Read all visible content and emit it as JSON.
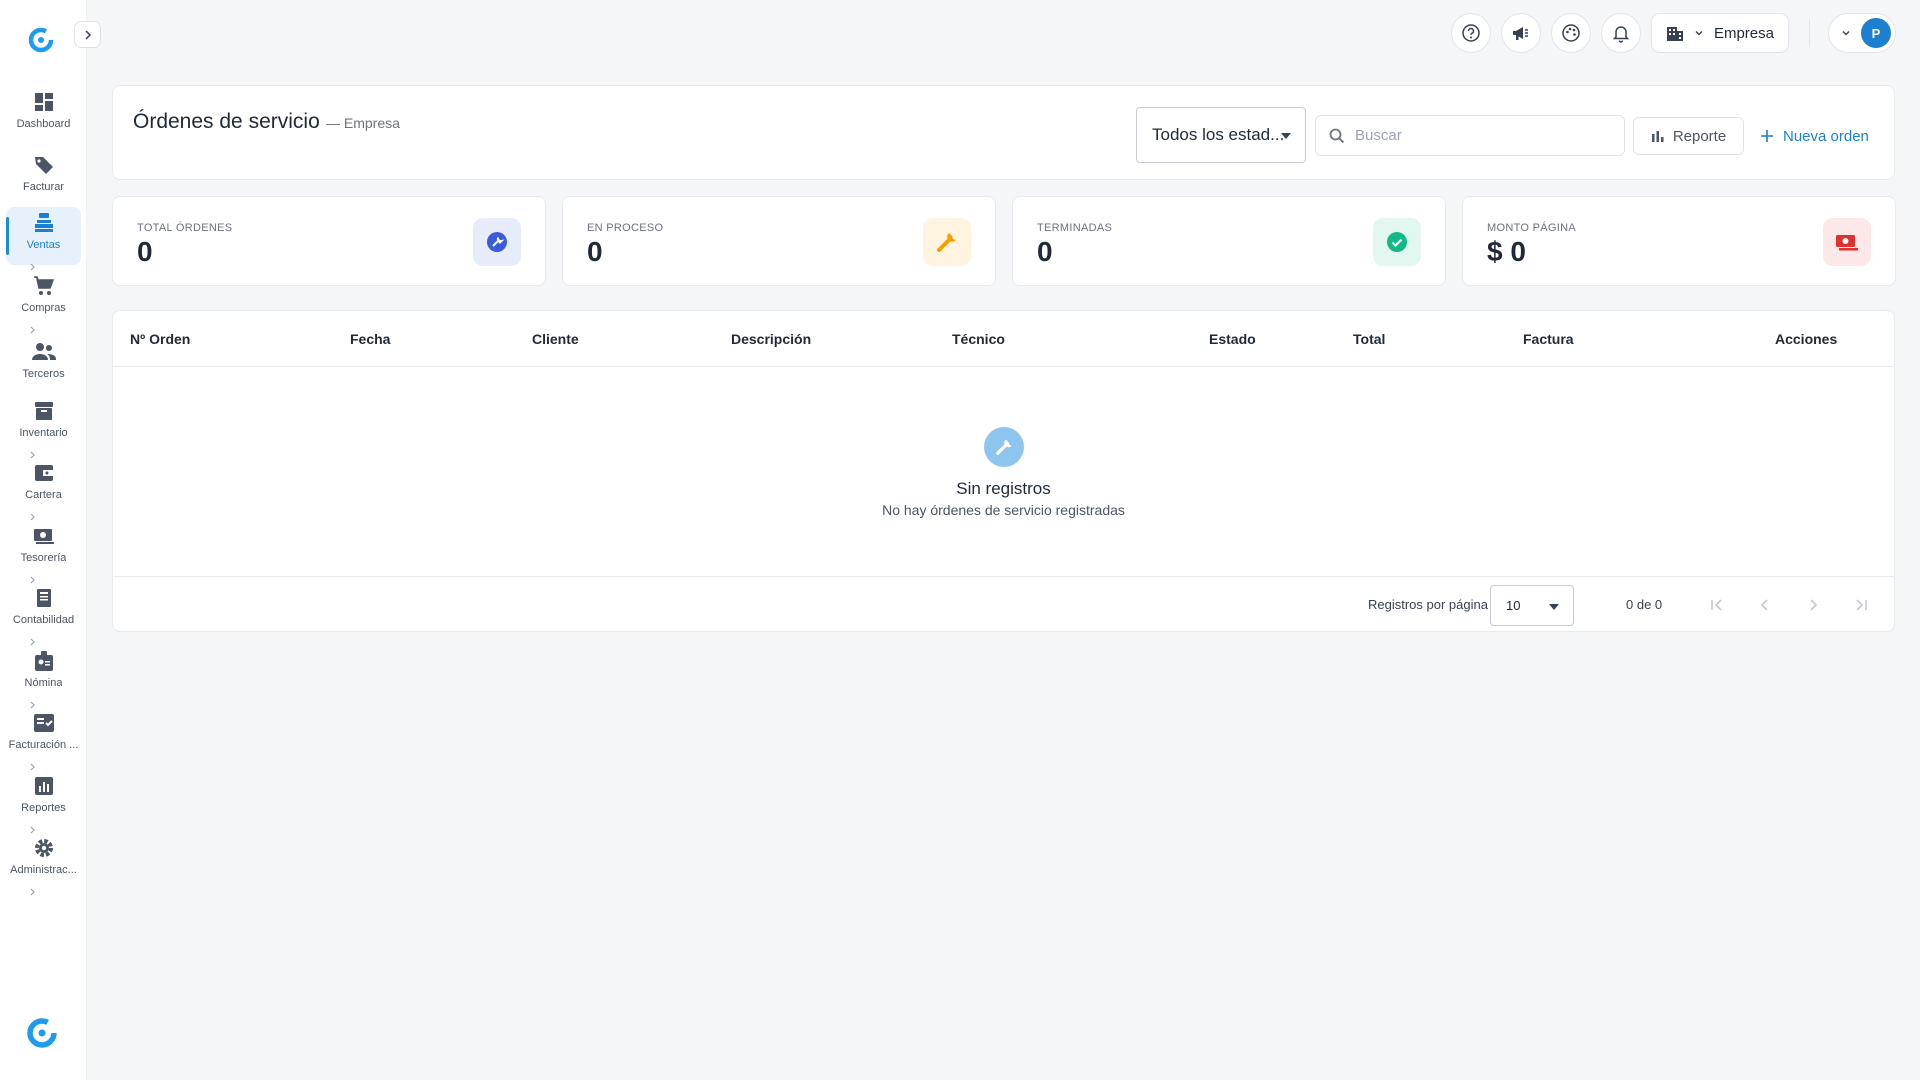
{
  "sidebar": {
    "items": [
      {
        "label": "Dashboard",
        "icon": "dashboard-icon"
      },
      {
        "label": "Facturar",
        "icon": "tag-icon"
      },
      {
        "label": "Ventas",
        "icon": "pos-register-icon"
      },
      {
        "label": "Compras",
        "icon": "cart-icon"
      },
      {
        "label": "Terceros",
        "icon": "people-icon"
      },
      {
        "label": "Inventario",
        "icon": "archive-box-icon"
      },
      {
        "label": "Cartera",
        "icon": "wallet-icon"
      },
      {
        "label": "Tesorería",
        "icon": "money-icon"
      },
      {
        "label": "Contabilidad",
        "icon": "ledger-icon"
      },
      {
        "label": "Nómina",
        "icon": "id-badge-icon"
      },
      {
        "label": "Facturación ...",
        "icon": "invoice-check-icon"
      },
      {
        "label": "Reportes",
        "icon": "bar-chart-icon"
      },
      {
        "label": "Administrac...",
        "icon": "gear-icon"
      }
    ],
    "active": "Ventas"
  },
  "topbar": {
    "company_label": "Empresa",
    "avatar_initial": "P"
  },
  "header": {
    "title": "Órdenes de servicio",
    "subtitle": "— Empresa",
    "status_filter_value": "Todos los estad...",
    "search_placeholder": "Buscar",
    "report_label": "Reporte",
    "new_order_label": "Nueva orden"
  },
  "stats": [
    {
      "label": "TOTAL ÓRDENES",
      "value": "0",
      "icon": "wrench-circle-icon",
      "color": "#3b5bdb",
      "bg": "#e7ecfb"
    },
    {
      "label": "EN PROCESO",
      "value": "0",
      "icon": "wrench-icon",
      "color": "#f59f00",
      "bg": "#fff4e0"
    },
    {
      "label": "TERMINADAS",
      "value": "0",
      "icon": "check-circle-icon",
      "color": "#12b886",
      "bg": "#e2f7ef"
    },
    {
      "label": "MONTO PÁGINA",
      "value": "$ 0",
      "icon": "money-icon",
      "color": "#e03131",
      "bg": "#fde8e8"
    }
  ],
  "table": {
    "columns": [
      "Nº Orden",
      "Fecha",
      "Cliente",
      "Descripción",
      "Técnico",
      "Estado",
      "Total",
      "Factura",
      "Acciones"
    ],
    "rows": [],
    "empty_title": "Sin registros",
    "empty_subtitle": "No hay órdenes de servicio registradas"
  },
  "pagination": {
    "rows_per_page_label": "Registros por página",
    "rows_per_page_value": "10",
    "range_label": "0 de 0"
  },
  "colors": {
    "accent": "#1d7fcf",
    "background": "#f5f6f8"
  }
}
